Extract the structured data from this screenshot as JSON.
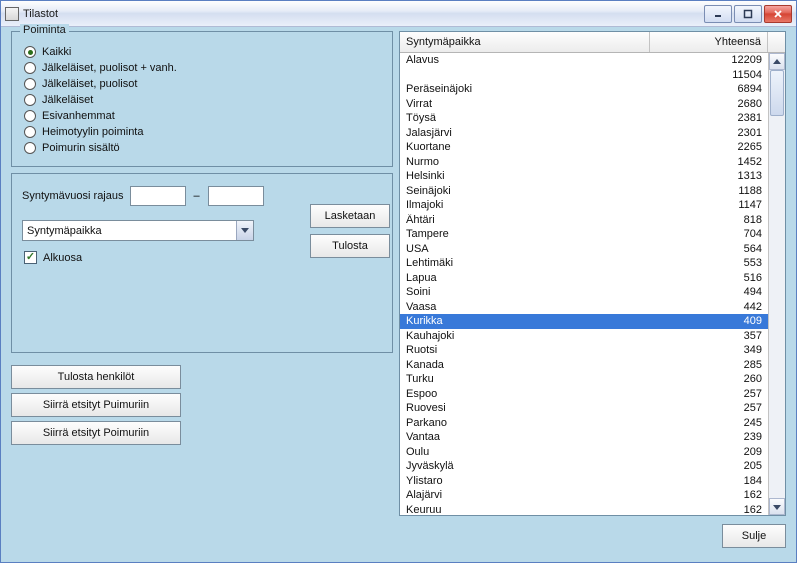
{
  "window": {
    "title": "Tilastot"
  },
  "poiminta": {
    "legend": "Poiminta",
    "options": [
      "Kaikki",
      "Jälkeläiset, puolisot + vanh.",
      "Jälkeläiset, puolisot",
      "Jälkeläiset",
      "Esivanhemmat",
      "Heimotyylin poiminta",
      "Poimurin sisältö"
    ],
    "selected": 0
  },
  "filters": {
    "year_label": "Syntymävuosi rajaus",
    "year_from": "",
    "year_to": "",
    "dropdown_value": "Syntymäpaikka",
    "alkuosa_label": "Alkuosa",
    "alkuosa_checked": true
  },
  "buttons": {
    "calculate": "Lasketaan",
    "print": "Tulosta",
    "print_persons": "Tulosta henkilöt",
    "move_puimuri": "Siirrä etsityt Puimuriin",
    "move_poimuri": "Siirrä etsityt Poimuriin",
    "close": "Sulje"
  },
  "list": {
    "col_place": "Syntymäpaikka",
    "col_total": "Yhteensä",
    "selected_index": 17,
    "rows": [
      {
        "place": "Alavus",
        "total": 12209
      },
      {
        "place": "",
        "total": 11504
      },
      {
        "place": "Peräseinäjoki",
        "total": 6894
      },
      {
        "place": "Virrat",
        "total": 2680
      },
      {
        "place": "Töysä",
        "total": 2381
      },
      {
        "place": "Jalasjärvi",
        "total": 2301
      },
      {
        "place": "Kuortane",
        "total": 2265
      },
      {
        "place": "Nurmo",
        "total": 1452
      },
      {
        "place": "Helsinki",
        "total": 1313
      },
      {
        "place": "Seinäjoki",
        "total": 1188
      },
      {
        "place": "Ilmajoki",
        "total": 1147
      },
      {
        "place": "Ähtäri",
        "total": 818
      },
      {
        "place": "Tampere",
        "total": 704
      },
      {
        "place": "USA",
        "total": 564
      },
      {
        "place": "Lehtimäki",
        "total": 553
      },
      {
        "place": "Lapua",
        "total": 516
      },
      {
        "place": "Soini",
        "total": 494
      },
      {
        "place": "Vaasa",
        "total": 442
      },
      {
        "place": "Kurikka",
        "total": 409
      },
      {
        "place": "Kauhajoki",
        "total": 357
      },
      {
        "place": "Ruotsi",
        "total": 349
      },
      {
        "place": "Kanada",
        "total": 285
      },
      {
        "place": "Turku",
        "total": 260
      },
      {
        "place": "Espoo",
        "total": 257
      },
      {
        "place": "Ruovesi",
        "total": 257
      },
      {
        "place": "Parkano",
        "total": 245
      },
      {
        "place": "Vantaa",
        "total": 239
      },
      {
        "place": "Oulu",
        "total": 209
      },
      {
        "place": "Jyväskylä",
        "total": 205
      },
      {
        "place": "Ylistaro",
        "total": 184
      },
      {
        "place": "Alajärvi",
        "total": 162
      },
      {
        "place": "Keuruu",
        "total": 162
      }
    ]
  }
}
